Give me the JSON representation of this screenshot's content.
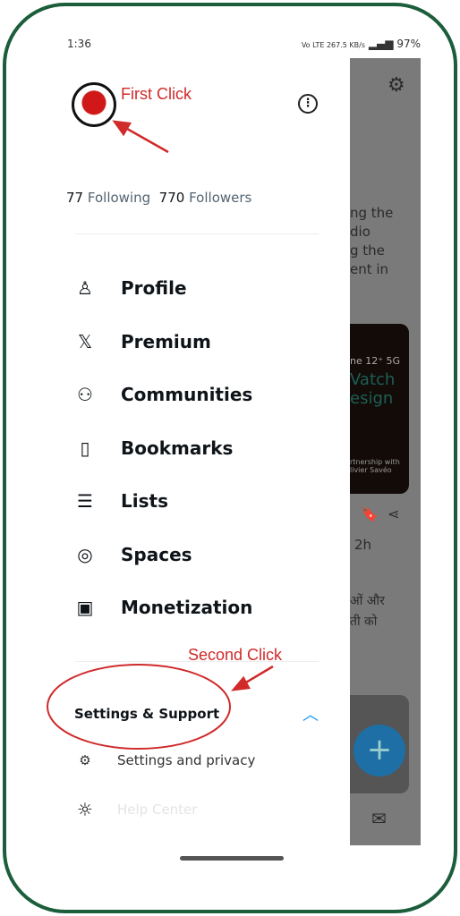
{
  "status": {
    "time": "1:36",
    "network": "Vo LTE 267.5 KB/s",
    "battery": "97%"
  },
  "profile": {
    "following_count": "77",
    "following_label": "Following",
    "followers_count": "770",
    "followers_label": "Followers"
  },
  "nav": [
    {
      "label": "Profile",
      "icon": "person-icon"
    },
    {
      "label": "Premium",
      "icon": "x-logo-icon"
    },
    {
      "label": "Communities",
      "icon": "communities-icon"
    },
    {
      "label": "Bookmarks",
      "icon": "bookmark-icon"
    },
    {
      "label": "Lists",
      "icon": "list-icon"
    },
    {
      "label": "Spaces",
      "icon": "spaces-icon"
    },
    {
      "label": "Monetization",
      "icon": "money-icon"
    }
  ],
  "section": {
    "title": "Settings & Support",
    "items": [
      {
        "label": "Settings and privacy",
        "icon": "gear-icon"
      },
      {
        "label": "Help Center",
        "icon": "help-icon"
      }
    ]
  },
  "annotations": {
    "first": "First Click",
    "second": "Second Click",
    "color": "#d02a2a"
  },
  "background": {
    "lines": "ng the\ndio\ng the\nent in",
    "card_line1": "ne 12⁺ 5G",
    "card_line2": "Vatch\nesign",
    "card_line3": "rtnership with\nlivier Savéo",
    "time": "2h",
    "hindi1": "ओं और",
    "hindi2": "ती को"
  }
}
